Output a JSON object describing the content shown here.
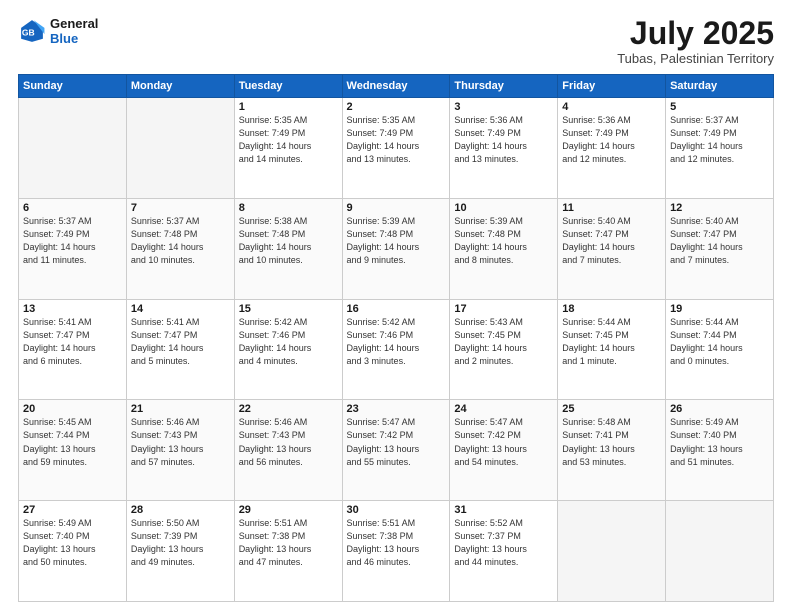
{
  "header": {
    "logo_line1": "General",
    "logo_line2": "Blue",
    "month": "July 2025",
    "location": "Tubas, Palestinian Territory"
  },
  "weekdays": [
    "Sunday",
    "Monday",
    "Tuesday",
    "Wednesday",
    "Thursday",
    "Friday",
    "Saturday"
  ],
  "weeks": [
    [
      {
        "day": "",
        "info": ""
      },
      {
        "day": "",
        "info": ""
      },
      {
        "day": "1",
        "info": "Sunrise: 5:35 AM\nSunset: 7:49 PM\nDaylight: 14 hours\nand 14 minutes."
      },
      {
        "day": "2",
        "info": "Sunrise: 5:35 AM\nSunset: 7:49 PM\nDaylight: 14 hours\nand 13 minutes."
      },
      {
        "day": "3",
        "info": "Sunrise: 5:36 AM\nSunset: 7:49 PM\nDaylight: 14 hours\nand 13 minutes."
      },
      {
        "day": "4",
        "info": "Sunrise: 5:36 AM\nSunset: 7:49 PM\nDaylight: 14 hours\nand 12 minutes."
      },
      {
        "day": "5",
        "info": "Sunrise: 5:37 AM\nSunset: 7:49 PM\nDaylight: 14 hours\nand 12 minutes."
      }
    ],
    [
      {
        "day": "6",
        "info": "Sunrise: 5:37 AM\nSunset: 7:49 PM\nDaylight: 14 hours\nand 11 minutes."
      },
      {
        "day": "7",
        "info": "Sunrise: 5:37 AM\nSunset: 7:48 PM\nDaylight: 14 hours\nand 10 minutes."
      },
      {
        "day": "8",
        "info": "Sunrise: 5:38 AM\nSunset: 7:48 PM\nDaylight: 14 hours\nand 10 minutes."
      },
      {
        "day": "9",
        "info": "Sunrise: 5:39 AM\nSunset: 7:48 PM\nDaylight: 14 hours\nand 9 minutes."
      },
      {
        "day": "10",
        "info": "Sunrise: 5:39 AM\nSunset: 7:48 PM\nDaylight: 14 hours\nand 8 minutes."
      },
      {
        "day": "11",
        "info": "Sunrise: 5:40 AM\nSunset: 7:47 PM\nDaylight: 14 hours\nand 7 minutes."
      },
      {
        "day": "12",
        "info": "Sunrise: 5:40 AM\nSunset: 7:47 PM\nDaylight: 14 hours\nand 7 minutes."
      }
    ],
    [
      {
        "day": "13",
        "info": "Sunrise: 5:41 AM\nSunset: 7:47 PM\nDaylight: 14 hours\nand 6 minutes."
      },
      {
        "day": "14",
        "info": "Sunrise: 5:41 AM\nSunset: 7:47 PM\nDaylight: 14 hours\nand 5 minutes."
      },
      {
        "day": "15",
        "info": "Sunrise: 5:42 AM\nSunset: 7:46 PM\nDaylight: 14 hours\nand 4 minutes."
      },
      {
        "day": "16",
        "info": "Sunrise: 5:42 AM\nSunset: 7:46 PM\nDaylight: 14 hours\nand 3 minutes."
      },
      {
        "day": "17",
        "info": "Sunrise: 5:43 AM\nSunset: 7:45 PM\nDaylight: 14 hours\nand 2 minutes."
      },
      {
        "day": "18",
        "info": "Sunrise: 5:44 AM\nSunset: 7:45 PM\nDaylight: 14 hours\nand 1 minute."
      },
      {
        "day": "19",
        "info": "Sunrise: 5:44 AM\nSunset: 7:44 PM\nDaylight: 14 hours\nand 0 minutes."
      }
    ],
    [
      {
        "day": "20",
        "info": "Sunrise: 5:45 AM\nSunset: 7:44 PM\nDaylight: 13 hours\nand 59 minutes."
      },
      {
        "day": "21",
        "info": "Sunrise: 5:46 AM\nSunset: 7:43 PM\nDaylight: 13 hours\nand 57 minutes."
      },
      {
        "day": "22",
        "info": "Sunrise: 5:46 AM\nSunset: 7:43 PM\nDaylight: 13 hours\nand 56 minutes."
      },
      {
        "day": "23",
        "info": "Sunrise: 5:47 AM\nSunset: 7:42 PM\nDaylight: 13 hours\nand 55 minutes."
      },
      {
        "day": "24",
        "info": "Sunrise: 5:47 AM\nSunset: 7:42 PM\nDaylight: 13 hours\nand 54 minutes."
      },
      {
        "day": "25",
        "info": "Sunrise: 5:48 AM\nSunset: 7:41 PM\nDaylight: 13 hours\nand 53 minutes."
      },
      {
        "day": "26",
        "info": "Sunrise: 5:49 AM\nSunset: 7:40 PM\nDaylight: 13 hours\nand 51 minutes."
      }
    ],
    [
      {
        "day": "27",
        "info": "Sunrise: 5:49 AM\nSunset: 7:40 PM\nDaylight: 13 hours\nand 50 minutes."
      },
      {
        "day": "28",
        "info": "Sunrise: 5:50 AM\nSunset: 7:39 PM\nDaylight: 13 hours\nand 49 minutes."
      },
      {
        "day": "29",
        "info": "Sunrise: 5:51 AM\nSunset: 7:38 PM\nDaylight: 13 hours\nand 47 minutes."
      },
      {
        "day": "30",
        "info": "Sunrise: 5:51 AM\nSunset: 7:38 PM\nDaylight: 13 hours\nand 46 minutes."
      },
      {
        "day": "31",
        "info": "Sunrise: 5:52 AM\nSunset: 7:37 PM\nDaylight: 13 hours\nand 44 minutes."
      },
      {
        "day": "",
        "info": ""
      },
      {
        "day": "",
        "info": ""
      }
    ]
  ]
}
